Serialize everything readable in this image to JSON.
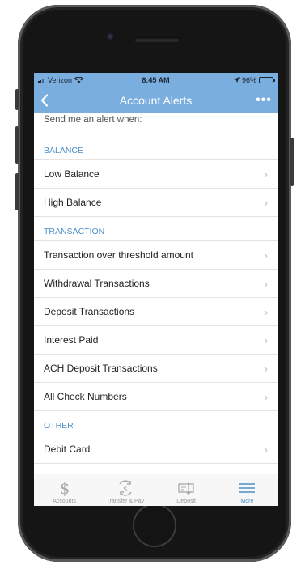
{
  "status_bar": {
    "carrier": "Verizon",
    "time": "8:45 AM",
    "battery": "96%",
    "battery_level": 0.96
  },
  "nav": {
    "title": "Account Alerts",
    "more_label": "•••"
  },
  "intro": "Send me an alert when:",
  "sections": [
    {
      "header": "BALANCE",
      "items": [
        "Low Balance",
        "High Balance"
      ]
    },
    {
      "header": "TRANSACTION",
      "items": [
        "Transaction over threshold amount",
        "Withdrawal Transactions",
        "Deposit Transactions",
        "Interest Paid",
        "ACH Deposit Transactions",
        "All Check Numbers"
      ]
    },
    {
      "header": "OTHER",
      "items": [
        "Debit Card"
      ]
    }
  ],
  "chevron": "›",
  "tabs": [
    {
      "label": "Accounts",
      "icon": "dollar-icon"
    },
    {
      "label": "Transfer & Pay",
      "icon": "transfer-icon"
    },
    {
      "label": "Deposit",
      "icon": "check-deposit-icon"
    },
    {
      "label": "More",
      "icon": "menu-icon",
      "active": true
    }
  ],
  "colors": {
    "header_blue": "#7aaedf",
    "accent_blue": "#4c8fc9"
  }
}
